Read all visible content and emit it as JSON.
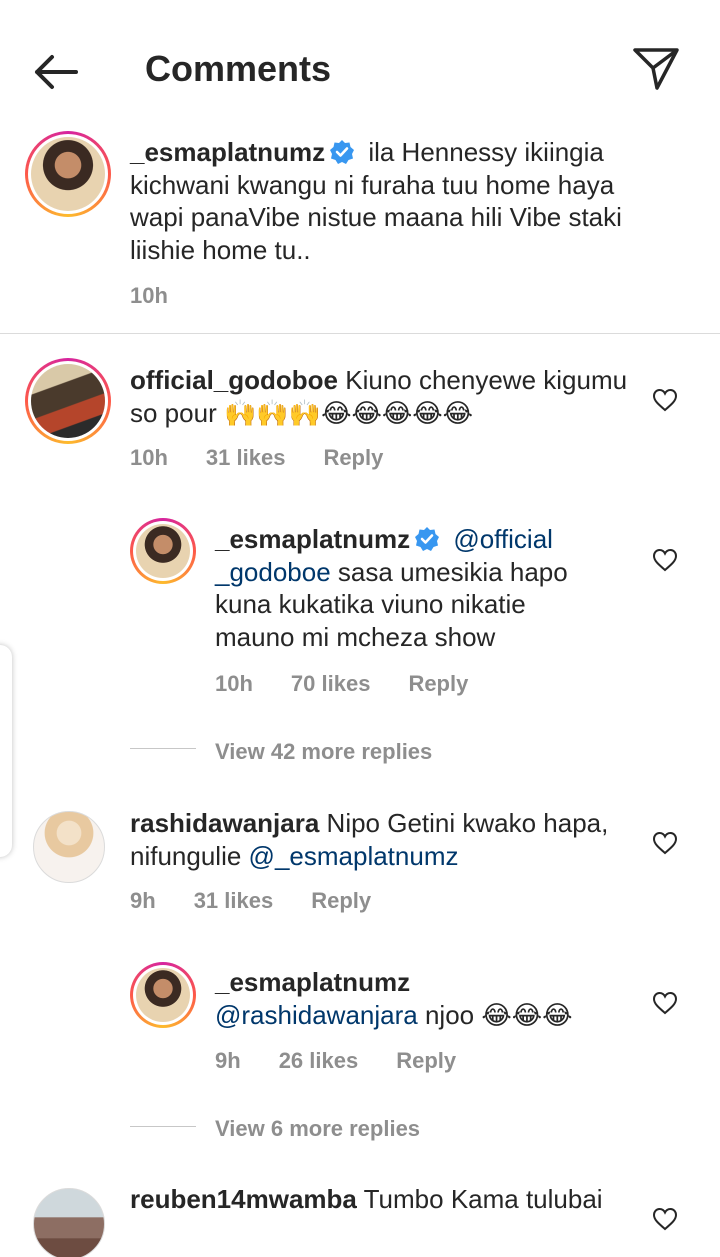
{
  "header": {
    "title": "Comments"
  },
  "caption": {
    "username": "_esmaplatnumz",
    "text": "ila Hennessy ikiingia kichwani kwangu ni furaha tuu home haya wapi panaVibe nistue maana hili Vibe staki liishie home tu..",
    "time": "10h"
  },
  "comments": [
    {
      "username": "official_godoboe",
      "text": "Kiuno chenyewe kigumu so pour 🙌🙌🙌😂😂😂😂😂",
      "time": "10h",
      "likes": "31 likes",
      "reply_label": "Reply",
      "reply": {
        "username": "_esmaplatnumz",
        "mention": "@official _godoboe",
        "text": "sasa umesikia hapo kuna kukatika viuno nikatie mauno mi mcheza show",
        "time": "10h",
        "likes": "70 likes",
        "reply_label": "Reply"
      },
      "view_more": "View 42 more replies"
    },
    {
      "username": "rashidawanjara",
      "text": "Nipo Getini kwako hapa, nifungulie",
      "mention": "@_esmaplatnumz",
      "time": "9h",
      "likes": "31 likes",
      "reply_label": "Reply",
      "reply": {
        "username": "_esmaplatnumz",
        "mention": "@rashidawanjara",
        "text": "njoo 😂😂😂",
        "time": "9h",
        "likes": "26 likes",
        "reply_label": "Reply"
      },
      "view_more": "View 6 more replies"
    },
    {
      "username": "reuben14mwamba",
      "text": "Tumbo Kama tulubai"
    }
  ],
  "colors": {
    "text": "#262626",
    "secondary": "#8e8e8e",
    "mention": "#00376b",
    "verified": "#3897f0",
    "divider": "#dbdbdb"
  },
  "icons": [
    "back-arrow-icon",
    "send-icon",
    "verified-badge-icon",
    "heart-icon"
  ]
}
